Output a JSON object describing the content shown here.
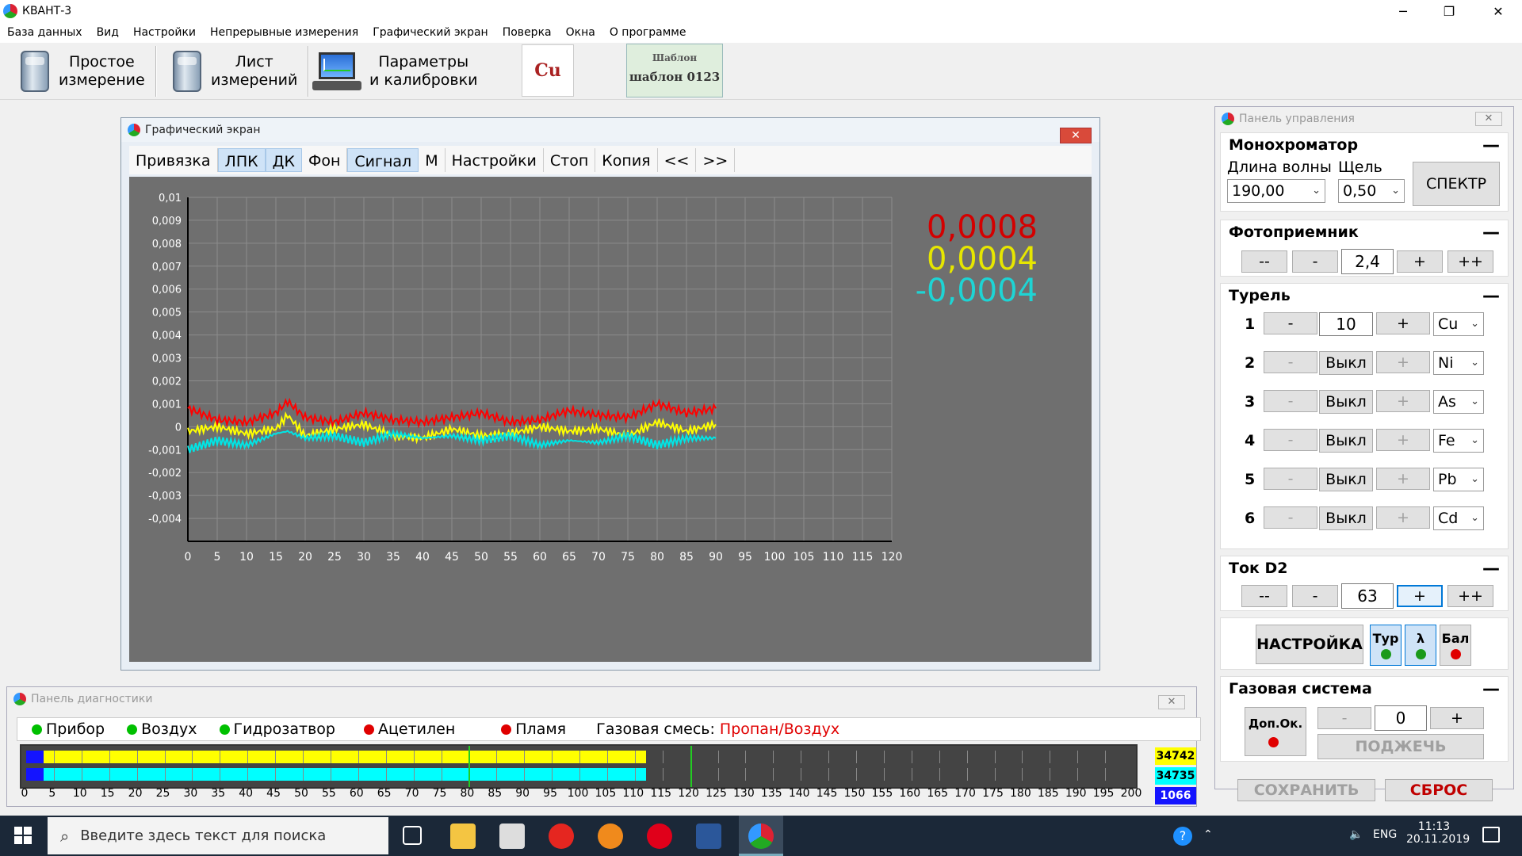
{
  "window": {
    "title": "КВАНТ-3",
    "minimize": "─",
    "maximize": "❐",
    "close": "✕"
  },
  "menu": [
    "База данных",
    "Вид",
    "Настройки",
    "Непрерывные измерения",
    "Графический экран",
    "Поверка",
    "Окна",
    "О программе"
  ],
  "toolbar": {
    "simple_line1": "Простое",
    "simple_line2": "измерение",
    "sheet_line1": "Лист",
    "sheet_line2": "измерений",
    "params_line1": "Параметры",
    "params_line2": "и калибровки",
    "element": "Cu",
    "template_label": "Шаблон",
    "template_value": "шаблон 0123"
  },
  "graph": {
    "title": "Графический экран",
    "close": "✕",
    "tabs": [
      "Привязка",
      "ЛПК",
      "ДК",
      "Фон",
      "Сигнал",
      "М",
      "Настройки",
      "Стоп",
      "Копия",
      "<<",
      ">>"
    ],
    "active_tabs": [
      "ЛПК",
      "ДК",
      "Сигнал"
    ],
    "readouts": [
      {
        "value": "0,0008",
        "color": "#d40000"
      },
      {
        "value": "0,0004",
        "color": "#e6e600"
      },
      {
        "value": "-0,0004",
        "color": "#1ed4d4"
      }
    ]
  },
  "chart_data": {
    "type": "line",
    "xlim": [
      0,
      120
    ],
    "ylim": [
      -0.005,
      0.01
    ],
    "x_ticks": [
      "0",
      "5",
      "10",
      "15",
      "20",
      "25",
      "30",
      "35",
      "40",
      "45",
      "50",
      "55",
      "60",
      "65",
      "70",
      "75",
      "80",
      "85",
      "90",
      "95",
      "100",
      "105",
      "110",
      "115",
      "120"
    ],
    "y_ticks": [
      "0,01",
      "0,009",
      "0,008",
      "0,007",
      "0,006",
      "0,005",
      "0,004",
      "0,003",
      "0,002",
      "0,001",
      "0",
      "-0,001",
      "-0,002",
      "-0,003",
      "-0,004"
    ],
    "grid": true,
    "series": [
      {
        "color": "#ff0000",
        "x": [
          0,
          5,
          10,
          15,
          17,
          20,
          25,
          30,
          35,
          40,
          45,
          50,
          55,
          60,
          65,
          70,
          75,
          80,
          85,
          90
        ],
        "y": [
          0.0008,
          0.0003,
          0.0002,
          0.0006,
          0.0011,
          0.0004,
          0.0002,
          0.0006,
          0.0003,
          0.0002,
          0.0004,
          0.0006,
          0.0002,
          0.0003,
          0.0007,
          0.0005,
          0.0004,
          0.001,
          0.0006,
          0.0008
        ]
      },
      {
        "color": "#ffff00",
        "x": [
          0,
          5,
          10,
          15,
          17,
          20,
          25,
          30,
          35,
          40,
          45,
          50,
          55,
          60,
          65,
          70,
          75,
          80,
          85,
          90
        ],
        "y": [
          -0.0002,
          0.0,
          -0.0003,
          -0.0001,
          0.0005,
          -0.0004,
          -0.0001,
          0.0001,
          -0.0004,
          -0.0005,
          -0.0001,
          -0.0004,
          -0.0003,
          0.0,
          -0.0002,
          -0.0001,
          -0.0004,
          0.0002,
          -0.0002,
          0.0001
        ]
      },
      {
        "color": "#00e5e5",
        "x": [
          0,
          5,
          10,
          15,
          17,
          20,
          25,
          30,
          35,
          40,
          45,
          50,
          55,
          60,
          65,
          70,
          75,
          80,
          85,
          90
        ],
        "y": [
          -0.001,
          -0.0006,
          -0.0008,
          -0.0003,
          -0.0002,
          -0.0005,
          -0.0004,
          -0.0007,
          -0.0003,
          -0.0005,
          -0.0004,
          -0.0006,
          -0.0004,
          -0.0008,
          -0.0006,
          -0.0007,
          -0.0004,
          -0.0008,
          -0.0005,
          -0.0005
        ]
      }
    ]
  },
  "diagnostics": {
    "title": "Панель диагностики",
    "close": "✕",
    "status": [
      {
        "label": "Прибор",
        "color": "#00c000"
      },
      {
        "label": "Воздух",
        "color": "#00c000"
      },
      {
        "label": "Гидрозатвор",
        "color": "#00c000"
      },
      {
        "label": "Ацетилен",
        "color": "#e00000"
      },
      {
        "label": "Пламя",
        "color": "#e00000"
      }
    ],
    "gas_label": "Газовая смесь:",
    "gas_value": "Пропан/Воздух",
    "bar_values": [
      "34742",
      "34735",
      "1066"
    ],
    "bar_colors": [
      "#ffff00",
      "#00ffff",
      "#1414ff"
    ],
    "bar_fraction": [
      0.54,
      0.54
    ],
    "axis_ticks": [
      "0",
      "5",
      "10",
      "15",
      "20",
      "25",
      "30",
      "35",
      "40",
      "45",
      "50",
      "55",
      "60",
      "65",
      "70",
      "75",
      "80",
      "85",
      "90",
      "95",
      "100",
      "105",
      "110",
      "115",
      "120",
      "125",
      "130",
      "135",
      "140",
      "145",
      "150",
      "155",
      "160",
      "165",
      "170",
      "175",
      "180",
      "185",
      "190",
      "195",
      "200"
    ]
  },
  "control": {
    "title": "Панель управления",
    "close": "✕",
    "mono": {
      "header": "Монохроматор",
      "wl_label": "Длина волны",
      "slit_label": "Щель",
      "wl_value": "190,00",
      "slit_value": "0,50",
      "spectrum_btn": "СПЕКТР"
    },
    "photo": {
      "header": "Фотоприемник",
      "dec2": "--",
      "dec": "-",
      "value": "2,4",
      "inc": "+",
      "inc2": "++"
    },
    "turret": {
      "header": "Турель",
      "rows": [
        {
          "n": "1",
          "minus": "-",
          "value": "10",
          "plus": "+",
          "el": "Cu"
        },
        {
          "n": "2",
          "minus": "-",
          "value": "Выкл",
          "plus": "+",
          "el": "Ni"
        },
        {
          "n": "3",
          "minus": "-",
          "value": "Выкл",
          "plus": "+",
          "el": "As"
        },
        {
          "n": "4",
          "minus": "-",
          "value": "Выкл",
          "plus": "+",
          "el": "Fe"
        },
        {
          "n": "5",
          "minus": "-",
          "value": "Выкл",
          "plus": "+",
          "el": "Pb"
        },
        {
          "n": "6",
          "minus": "-",
          "value": "Выкл",
          "plus": "+",
          "el": "Cd"
        }
      ]
    },
    "d2": {
      "header": "Ток D2",
      "dec2": "--",
      "dec": "-",
      "value": "63",
      "inc": "+",
      "inc2": "++"
    },
    "setup": {
      "btn": "НАСТРОЙКА",
      "tur": "Тур",
      "lambda": "λ",
      "bal": "Бал"
    },
    "gas": {
      "header": "Газовая система",
      "extra": "Доп.Ок.",
      "minus": "-",
      "value": "0",
      "plus": "+",
      "ignite": "ПОДЖЕЧЬ"
    },
    "save": "СОХРАНИТЬ",
    "reset": "СБРОС",
    "collapse": "—"
  },
  "taskbar": {
    "search_placeholder": "Введите здесь текст для поиска",
    "lang": "ENG",
    "time": "11:13",
    "date": "20.11.2019"
  }
}
